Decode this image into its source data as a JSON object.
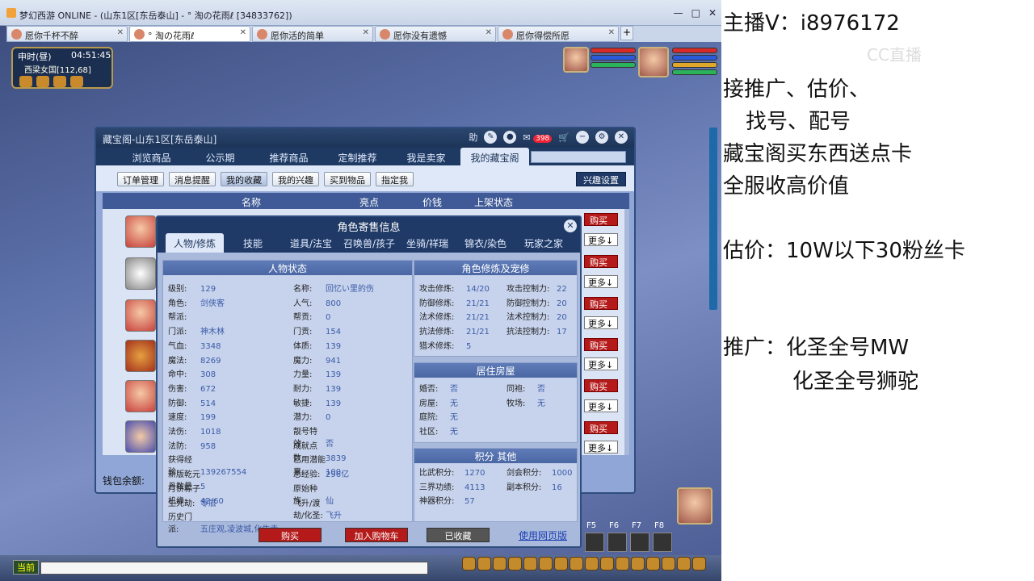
{
  "window": {
    "title": "梦幻西游 ONLINE - (山东1区[东岳泰山] - ° 淘の花雨ℓ [34833762])",
    "controls": [
      "—",
      "□",
      "✕"
    ]
  },
  "browser_tabs": [
    {
      "label": "愿你千杯不醉",
      "close": "✕"
    },
    {
      "label": "° 淘の花雨ℓ",
      "close": "✕"
    },
    {
      "label": "愿你活的简单",
      "close": "✕"
    },
    {
      "label": "愿你没有遗憾",
      "close": "✕"
    },
    {
      "label": "愿你得偿所愿",
      "close": "✕"
    }
  ],
  "tab_add": "+",
  "hud": {
    "time_label": "申时(昼)",
    "clock": "04:51:45",
    "location": "西梁女国[112,68]"
  },
  "panel": {
    "title": "藏宝阁-山东1区[东岳泰山]",
    "help": "助",
    "badge": "398",
    "nav": [
      "浏览商品",
      "公示期",
      "推荐商品",
      "定制推荐",
      "我是卖家",
      "我的藏宝阁"
    ],
    "subnav": [
      "订单管理",
      "消息提醒",
      "我的收藏",
      "我的兴趣",
      "买到物品",
      "指定我"
    ],
    "interest_btn": "兴趣设置",
    "columns": [
      "名称",
      "亮点",
      "价钱",
      "上架状态"
    ],
    "row_buy": "购买",
    "row_more": "更多↓",
    "wallet_label": "钱包余额:"
  },
  "dialog": {
    "title": "角色寄售信息",
    "close": "✕",
    "tabs": [
      "人物/修炼",
      "技能",
      "道具/法宝",
      "召唤兽/孩子",
      "坐骑/祥瑞",
      "锦衣/染色",
      "玩家之家"
    ],
    "status_header": "人物状态",
    "xiulian_header": "角色修炼及宠修",
    "house_header": "居住房屋",
    "score_header": "积分 其他",
    "left_col": [
      {
        "k": "级别:",
        "v": "129"
      },
      {
        "k": "角色:",
        "v": "剑侠客"
      },
      {
        "k": "帮派:",
        "v": ""
      },
      {
        "k": "门派:",
        "v": "神木林"
      },
      {
        "k": "气血:",
        "v": "3348"
      },
      {
        "k": "魔法:",
        "v": "8269"
      },
      {
        "k": "命中:",
        "v": "308"
      },
      {
        "k": "伤害:",
        "v": "672"
      },
      {
        "k": "防御:",
        "v": "514"
      },
      {
        "k": "速度:",
        "v": "199"
      },
      {
        "k": "法伤:",
        "v": "1018"
      },
      {
        "k": "法防:",
        "v": "958"
      },
      {
        "k": "获得经验:",
        "v": "139267554"
      },
      {
        "k": "新版乾元丹数量",
        "v": "5"
      },
      {
        "k": "月饼粽子机缘:",
        "v": "42/60"
      },
      {
        "k": "生死劫:",
        "v": "零层"
      },
      {
        "k": "历史门派:",
        "v": "五庄观,凌波城,化生寺"
      }
    ],
    "mid_col": [
      {
        "k": "名称:",
        "v": "回忆い里的伤"
      },
      {
        "k": "人气:",
        "v": "800"
      },
      {
        "k": "帮贡:",
        "v": "0"
      },
      {
        "k": "门贡:",
        "v": "154"
      },
      {
        "k": "体质:",
        "v": "139"
      },
      {
        "k": "魔力:",
        "v": "941"
      },
      {
        "k": "力量:",
        "v": "139"
      },
      {
        "k": "耐力:",
        "v": "139"
      },
      {
        "k": "敏捷:",
        "v": "139"
      },
      {
        "k": "潜力:",
        "v": "0"
      },
      {
        "k": "靓号特效:",
        "v": "否"
      },
      {
        "k": "成就点数:",
        "v": "3839"
      },
      {
        "k": "已用潜能果:",
        "v": "100"
      },
      {
        "k": "总经验:",
        "v": "296亿"
      },
      {
        "k": "原始种族:",
        "v": "仙"
      },
      {
        "k": "飞升/渡劫/化圣:",
        "v": "飞升"
      }
    ],
    "xiulian_left": [
      {
        "k": "攻击修炼:",
        "v": "14/20"
      },
      {
        "k": "防御修炼:",
        "v": "21/21"
      },
      {
        "k": "法术修炼:",
        "v": "21/21"
      },
      {
        "k": "抗法修炼:",
        "v": "21/21"
      },
      {
        "k": "猎术修炼:",
        "v": "5"
      }
    ],
    "xiulian_right": [
      {
        "k": "攻击控制力:",
        "v": "22"
      },
      {
        "k": "防御控制力:",
        "v": "20"
      },
      {
        "k": "法术控制力:",
        "v": "20"
      },
      {
        "k": "抗法控制力:",
        "v": "17"
      }
    ],
    "house_left": [
      {
        "k": "婚否:",
        "v": "否"
      },
      {
        "k": "房屋:",
        "v": "无"
      },
      {
        "k": "庭院:",
        "v": "无"
      },
      {
        "k": "社区:",
        "v": "无"
      }
    ],
    "house_right": [
      {
        "k": "同袍:",
        "v": "否"
      },
      {
        "k": "牧场:",
        "v": "无"
      }
    ],
    "score_left": [
      {
        "k": "比武积分:",
        "v": "1270"
      },
      {
        "k": "三界功绩:",
        "v": "4113"
      },
      {
        "k": "神器积分:",
        "v": "57"
      }
    ],
    "score_right": [
      {
        "k": "剑会积分:",
        "v": "1000"
      },
      {
        "k": "副本积分:",
        "v": "16"
      }
    ],
    "buy": "购买",
    "add_cart": "加入购物车",
    "collected": "已收藏",
    "web_link": "使用网页版"
  },
  "bottom": {
    "current_btn": "当前",
    "hotkeys": [
      "F5",
      "F6",
      "F7",
      "F8"
    ]
  },
  "stream_text": {
    "line1": "主播V：i8976172",
    "line2": "接推广、估价、",
    "line3": "找号、配号",
    "line4": "藏宝阁买东西送点卡",
    "line5": "全服收高价值",
    "line6": "估价：10W以下30粉丝卡",
    "line7": "推广：化圣全号MW",
    "line8": "化圣全号狮驼",
    "watermark": "CC直播"
  }
}
